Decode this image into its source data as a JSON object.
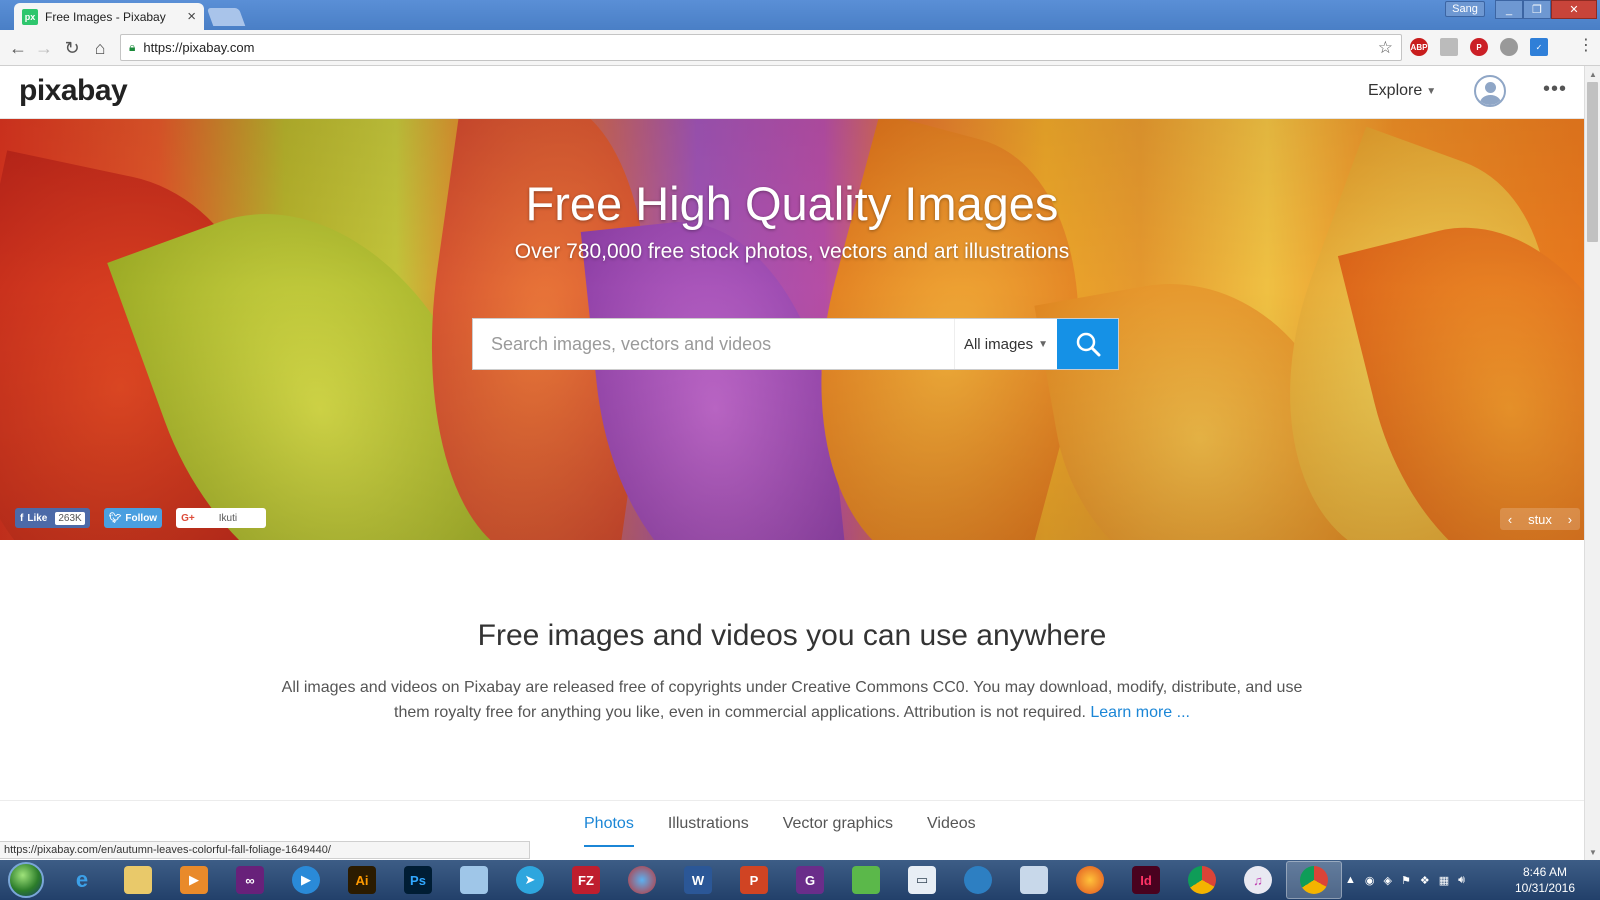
{
  "browser": {
    "tab_title": "Free Images - Pixabay",
    "tab_favicon_text": "px",
    "profile_name": "Sang",
    "url": "https://pixabay.com"
  },
  "header": {
    "logo_text": "pixabay",
    "explore_label": "Explore"
  },
  "hero": {
    "title": "Free High Quality Images",
    "subtitle": "Over 780,000 free stock photos, vectors and art illustrations",
    "search_placeholder": "Search images, vectors and videos",
    "type_select_value": "All images",
    "photo_credit": "stux",
    "social": {
      "facebook_label": "Like",
      "facebook_count": "263K",
      "twitter_label": "Follow",
      "google_label": "Ikuti"
    }
  },
  "intro": {
    "title": "Free images and videos you can use anywhere",
    "text": "All images and videos on Pixabay are released free of copyrights under Creative Commons CC0. You may download, modify, distribute, and use them royalty free for anything you like, even in commercial applications. Attribution is not required.",
    "learn_more": "Learn more ..."
  },
  "media_tabs": [
    "Photos",
    "Illustrations",
    "Vector graphics",
    "Videos"
  ],
  "active_media_tab": "Photos",
  "status_bar_url": "https://pixabay.com/en/autumn-leaves-colorful-fall-foliage-1649440/",
  "taskbar": {
    "apps": [
      "internet-explorer",
      "file-explorer",
      "media-player",
      "visual-studio",
      "player",
      "illustrator",
      "photoshop",
      "notepad",
      "telegram",
      "filezilla",
      "browser-sphere",
      "word",
      "powerpoint",
      "pdf-tool",
      "greenshot",
      "window-app",
      "sync-app",
      "ipod-app",
      "firefox",
      "indesign",
      "chrome",
      "itunes",
      "chrome-active"
    ],
    "ai_label": "Ai",
    "ps_label": "Ps",
    "fz_label": "FZ",
    "word_label": "W",
    "ppt_label": "P",
    "id_label": "Id",
    "time": "8:46 AM",
    "date": "10/31/2016"
  },
  "colors": {
    "accent": "#1591e6",
    "link": "#1b86d6",
    "facebook": "#4c6aa8",
    "twitter": "#4a9fe0",
    "taskbar": "#22406a"
  }
}
